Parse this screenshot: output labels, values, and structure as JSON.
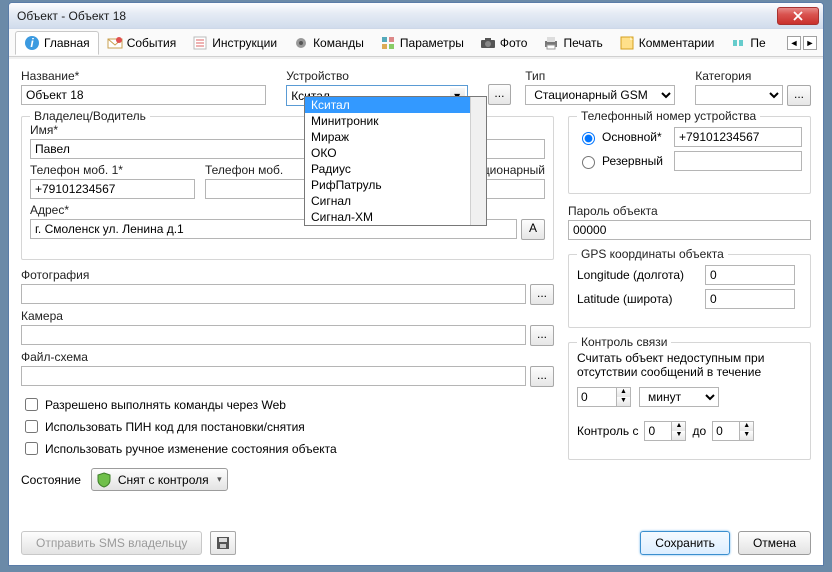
{
  "window": {
    "title": "Объект - Объект 18"
  },
  "tabs": [
    {
      "label": "Главная",
      "icon": "info-icon"
    },
    {
      "label": "События",
      "icon": "mail-icon"
    },
    {
      "label": "Инструкции",
      "icon": "list-icon"
    },
    {
      "label": "Команды",
      "icon": "gear-icon"
    },
    {
      "label": "Параметры",
      "icon": "grid-icon"
    },
    {
      "label": "Фото",
      "icon": "camera-icon"
    },
    {
      "label": "Печать",
      "icon": "printer-icon"
    },
    {
      "label": "Комментарии",
      "icon": "note-icon"
    },
    {
      "label": "Пе",
      "icon": "pager-icon"
    }
  ],
  "labels": {
    "name": "Название*",
    "device": "Устройство",
    "type": "Тип",
    "category": "Категория",
    "owner_group": "Владелец/Водитель",
    "owner_name": "Имя*",
    "phone1": "Телефон моб. 1*",
    "phone2": "Телефон моб.",
    "phone3": "ционарный",
    "address": "Адрес*",
    "photo": "Фотография",
    "camera": "Камера",
    "filescheme": "Файл-схема",
    "chk_web": "Разрешено выполнять команды через Web",
    "chk_pin": "Использовать ПИН код для постановки/снятия",
    "chk_manual": "Использовать ручное изменение состояния объекта",
    "state": "Состояние",
    "send_sms": "Отправить SMS владельцу",
    "phone_group": "Телефонный номер устройства",
    "phone_main": "Основной*",
    "phone_reserve": "Резервный",
    "password": "Пароль объекта",
    "gps_group": "GPS координаты объекта",
    "longitude": "Longitude (долгота)",
    "latitude": "Latitude (широта)",
    "link_group": "Контроль связи",
    "link_text": "Считать объект недоступным при отсутствии сообщений в течение",
    "control_from": "Контроль с",
    "to": "до",
    "save": "Сохранить",
    "cancel": "Отмена",
    "addr_btn": "A",
    "browse": "..."
  },
  "values": {
    "name": "Объект 18",
    "device": "Кситал",
    "type": "Стационарный GSM",
    "category": "",
    "owner_name": "Павел",
    "phone1": "+79101234567",
    "phone2": "",
    "phone3": "",
    "address": "г. Смоленск ул. Ленина д.1",
    "phone_main": "+79101234567",
    "phone_reserve": "",
    "password": "00000",
    "longitude": "0",
    "latitude": "0",
    "link_count": "0",
    "link_unit": "минут",
    "control_from": "0",
    "control_to": "0",
    "state": "Снят с контроля"
  },
  "device_options": [
    "Кситал",
    "Минитроник",
    "Мираж",
    "ОКО",
    "Радиус",
    "РифПатруль",
    "Сигнал",
    "Сигнал-ХМ"
  ]
}
